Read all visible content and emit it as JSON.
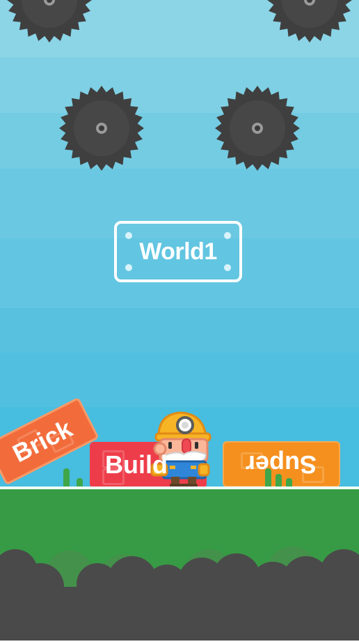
{
  "level_sign": {
    "label": "World1"
  },
  "bricks": [
    {
      "label": "Brick",
      "color": "#f26c3b"
    },
    {
      "label": "Build",
      "color": "#ee3d4a"
    },
    {
      "label": "Super",
      "color": "#f5901e"
    }
  ],
  "colors": {
    "sky_top": "#7fd0e4",
    "sky_bottom": "#46bde0",
    "ground": "#379b45",
    "saw": "#3f3f3f",
    "rocks": "#4a4a4a"
  },
  "icons": [
    "saw-blade-icon",
    "miner-character-icon",
    "grass-tuft-icon"
  ]
}
